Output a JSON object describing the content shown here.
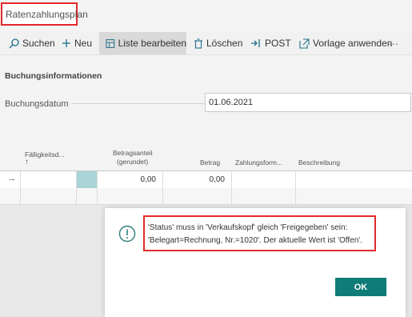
{
  "page": {
    "title": "Ratenzahlungsplan"
  },
  "toolbar": {
    "search": "Suchen",
    "new": "Neu",
    "edit_list": "Liste bearbeiten",
    "delete": "Löschen",
    "post": "POST",
    "apply_template": "Vorlage anwenden",
    "more": "···"
  },
  "section": {
    "title": "Buchungsinformationen"
  },
  "field": {
    "label": "Buchungsdatum",
    "value": "01.06.2021"
  },
  "grid": {
    "columns": {
      "due_date": "Fälligkeitsd...",
      "sort_arrow": "↑",
      "amount_part_line1": "Betragsanteil",
      "amount_part_line2": "(gerundet)",
      "amount": "Betrag",
      "payment_form": "Zahlungsform...",
      "description": "Beschreibung"
    },
    "row": {
      "marker": "→",
      "amount_part": "0,00",
      "amount": "0,00"
    }
  },
  "dialog": {
    "icon": "!",
    "line1": "'Status' muss in 'Verkaufskopf' gleich 'Freigegeben' sein:",
    "line2": "'Belegart=Rechnung, Nr.=1020'. Der aktuelle Wert ist 'Offen'.",
    "ok": "OK"
  },
  "colors": {
    "accent": "#107c78",
    "highlight": "#e4292b"
  }
}
